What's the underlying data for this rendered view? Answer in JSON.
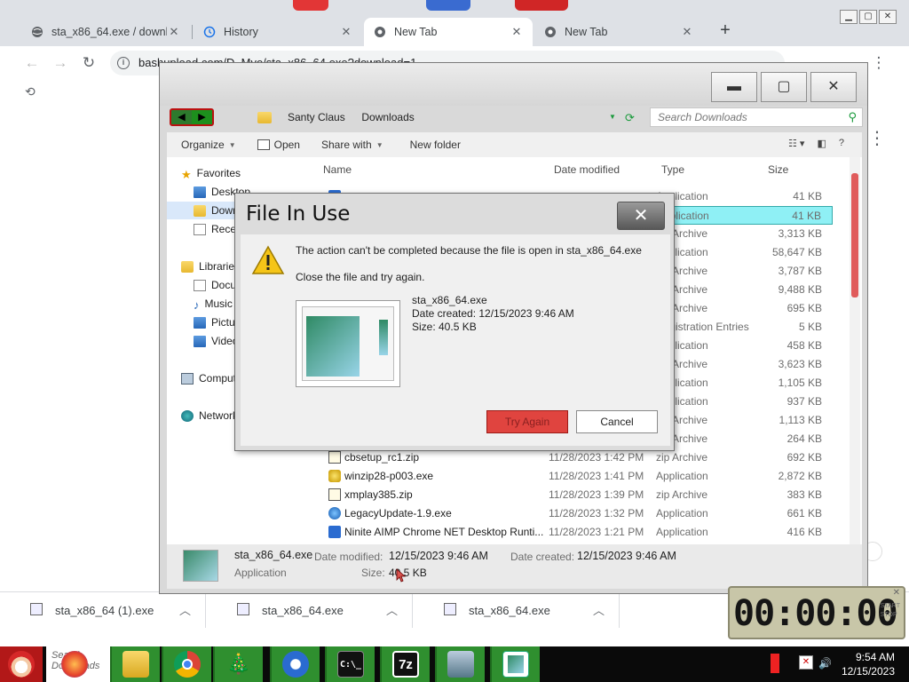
{
  "browser": {
    "tabs": [
      {
        "label": "sta_x86_64.exe / downlo",
        "close": "✕"
      },
      {
        "label": "History",
        "close": "✕"
      },
      {
        "label": "New Tab",
        "close": "✕"
      },
      {
        "label": "New Tab",
        "close": "✕"
      }
    ],
    "new_tab": "+",
    "url": "bashupload.com/D_Mvo/sta_x86_64.exe?download=1",
    "downloads": [
      {
        "label": "sta_x86_64 (1).exe"
      },
      {
        "label": "sta_x86_64.exe"
      },
      {
        "label": "sta_x86_64.exe"
      }
    ]
  },
  "explorer": {
    "breadcrumb": [
      "Santy Claus",
      "Downloads"
    ],
    "search_placeholder": "Search Downloads",
    "commands": {
      "organize": "Organize",
      "open": "Open",
      "share_with": "Share with",
      "new_folder": "New folder"
    },
    "nav": [
      {
        "label": "Favorites",
        "icon": "star-icon"
      },
      {
        "label": "Desktop",
        "icon": "desktop-icon"
      },
      {
        "label": "Downloads",
        "icon": "downloads-icon"
      },
      {
        "label": "Recent Places",
        "icon": "recent-icon"
      },
      {
        "label": "Libraries",
        "icon": "libraries-icon"
      },
      {
        "label": "Documents",
        "icon": "documents-icon"
      },
      {
        "label": "Music",
        "icon": "music-icon"
      },
      {
        "label": "Pictures",
        "icon": "pictures-icon"
      },
      {
        "label": "Videos",
        "icon": "videos-icon"
      },
      {
        "label": "Computer",
        "icon": "computer-icon"
      },
      {
        "label": "Network",
        "icon": "network-icon"
      }
    ],
    "columns": {
      "name": "Name",
      "date": "Date modified",
      "type": "Type",
      "size": "Size"
    },
    "files": [
      {
        "name": "",
        "date": "",
        "type": "Application",
        "size": "41 KB"
      },
      {
        "name": "",
        "date": "",
        "type": "Application",
        "size": "41 KB"
      },
      {
        "name": "",
        "date": "",
        "type": "zip Archive",
        "size": "3,313 KB"
      },
      {
        "name": "",
        "date": "",
        "type": "Application",
        "size": "58,647 KB"
      },
      {
        "name": "",
        "date": "",
        "type": "zip Archive",
        "size": "3,787 KB"
      },
      {
        "name": "",
        "date": "",
        "type": "zip Archive",
        "size": "9,488 KB"
      },
      {
        "name": "",
        "date": "",
        "type": "zip Archive",
        "size": "695 KB"
      },
      {
        "name": "",
        "date": "",
        "type": "Registration Entries",
        "size": "5 KB"
      },
      {
        "name": "",
        "date": "",
        "type": "Application",
        "size": "458 KB"
      },
      {
        "name": "",
        "date": "",
        "type": "zip Archive",
        "size": "3,623 KB"
      },
      {
        "name": "",
        "date": "",
        "type": "Application",
        "size": "1,105 KB"
      },
      {
        "name": "",
        "date": "",
        "type": "Application",
        "size": "937 KB"
      },
      {
        "name": "",
        "date": "",
        "type": "zip Archive",
        "size": "1,113 KB"
      },
      {
        "name": "",
        "date": "",
        "type": "zip Archive",
        "size": "264 KB"
      },
      {
        "name": "cbsetup_rc1.zip",
        "date": "11/28/2023 1:42 PM",
        "type": "zip Archive",
        "size": "692 KB"
      },
      {
        "name": "winzip28-p003.exe",
        "date": "11/28/2023 1:41 PM",
        "type": "Application",
        "size": "2,872 KB"
      },
      {
        "name": "xmplay385.zip",
        "date": "11/28/2023 1:39 PM",
        "type": "zip Archive",
        "size": "383 KB"
      },
      {
        "name": "LegacyUpdate-1.9.exe",
        "date": "11/28/2023 1:32 PM",
        "type": "Application",
        "size": "661 KB"
      },
      {
        "name": "Ninite AIMP Chrome NET Desktop Runti...",
        "date": "11/28/2023 1:21 PM",
        "type": "Application",
        "size": "416 KB"
      }
    ],
    "details": {
      "name": "sta_x86_64.exe",
      "kind": "Application",
      "modified_label": "Date modified:",
      "modified": "12/15/2023 9:46 AM",
      "created_label": "Date created:",
      "created": "12/15/2023 9:46 AM",
      "size_label": "Size:",
      "size": "40.5 KB"
    }
  },
  "dialog": {
    "title": "File In Use",
    "close": "✕",
    "message": "The action can't be completed because the file is open in sta_x86_64.exe",
    "hint": "Close the file and try again.",
    "file_name": "sta_x86_64.exe",
    "file_created": "Date created: 12/15/2023 9:46 AM",
    "file_size": "Size: 40.5 KB",
    "try_again": "Try Again",
    "cancel": "Cancel"
  },
  "clock_widget": {
    "display": "00:00:00"
  },
  "taskbar": {
    "search_placeholder": "Search Downloads",
    "time": "9:54 AM",
    "date": "12/15/2023",
    "apps": [
      "firefox-icon",
      "explorer-icon",
      "chrome-icon",
      "xmas-tree-icon",
      "thunderbird-icon",
      "cmd-icon",
      "7zip-icon",
      "network-icon",
      "reader-icon"
    ]
  },
  "colors": {
    "taskbar_green": "#2f8f2f",
    "start_red": "#b21818",
    "selection_cyan": "#8ff0f5",
    "try_again_red": "#e0443f"
  }
}
